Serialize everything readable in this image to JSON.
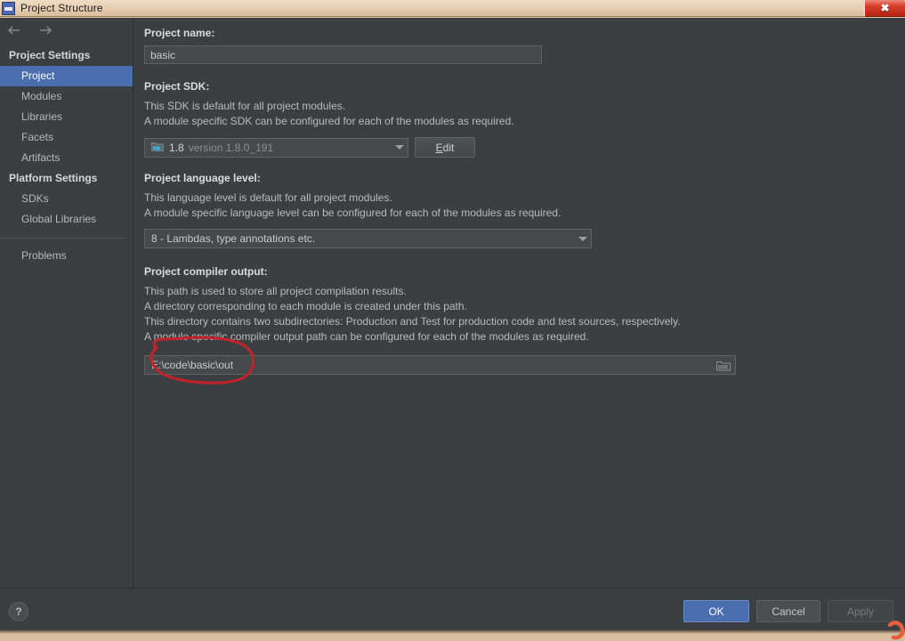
{
  "window": {
    "title": "Project Structure",
    "app_icon": "intellij-idea-icon",
    "close_label": "✖"
  },
  "nav": {
    "back_icon": "arrow-left-icon",
    "forward_icon": "arrow-right-icon"
  },
  "sidebar": {
    "groups": [
      {
        "label": "Project Settings",
        "items": [
          {
            "label": "Project",
            "selected": true
          },
          {
            "label": "Modules",
            "selected": false
          },
          {
            "label": "Libraries",
            "selected": false
          },
          {
            "label": "Facets",
            "selected": false
          },
          {
            "label": "Artifacts",
            "selected": false
          }
        ]
      },
      {
        "label": "Platform Settings",
        "items": [
          {
            "label": "SDKs",
            "selected": false
          },
          {
            "label": "Global Libraries",
            "selected": false
          }
        ]
      }
    ],
    "extra_items": [
      {
        "label": "Problems",
        "selected": false
      }
    ]
  },
  "content": {
    "project_name": {
      "label": "Project name:",
      "value": "basic"
    },
    "project_sdk": {
      "label": "Project SDK:",
      "desc_line1": "This SDK is default for all project modules.",
      "desc_line2": "A module specific SDK can be configured for each of the modules as required.",
      "selected_name": "1.8",
      "selected_version": "version 1.8.0_191",
      "sdk_icon": "java-sdk-folder-icon",
      "caret_icon": "chevron-down-icon",
      "edit_button": {
        "mnemonic": "E",
        "rest": "dit"
      }
    },
    "project_language_level": {
      "label": "Project language level:",
      "desc_line1": "This language level is default for all project modules.",
      "desc_line2": "A module specific language level can be configured for each of the modules as required.",
      "selected": "8 - Lambdas, type annotations etc.",
      "caret_icon": "chevron-down-icon"
    },
    "project_compiler_output": {
      "label": "Project compiler output:",
      "desc_line1": "This path is used to store all project compilation results.",
      "desc_line2": "A directory corresponding to each module is created under this path.",
      "desc_line3": "This directory contains two subdirectories: Production and Test for production code and test sources, respectively.",
      "desc_line4": "A module specific compiler output path can be configured for each of the modules as required.",
      "value": "E:\\code\\basic\\out",
      "browse_icon": "folder-browse-icon"
    }
  },
  "bottom": {
    "help_label": "?",
    "ok_label": "OK",
    "cancel_label": "Cancel",
    "apply_label": "Apply"
  },
  "annotation": {
    "type": "hand-drawn-red-ellipse",
    "target": "project compiler output path field",
    "color": "#c2232a"
  },
  "colors": {
    "window_bg": "#3c3f41",
    "field_bg": "#45494a",
    "selection_blue": "#4b6eaf",
    "text_primary": "#b8bbbd",
    "text_heading": "#dcdcdc",
    "titlebar_tan": "#e6cdb0",
    "close_red": "#d8422c"
  }
}
